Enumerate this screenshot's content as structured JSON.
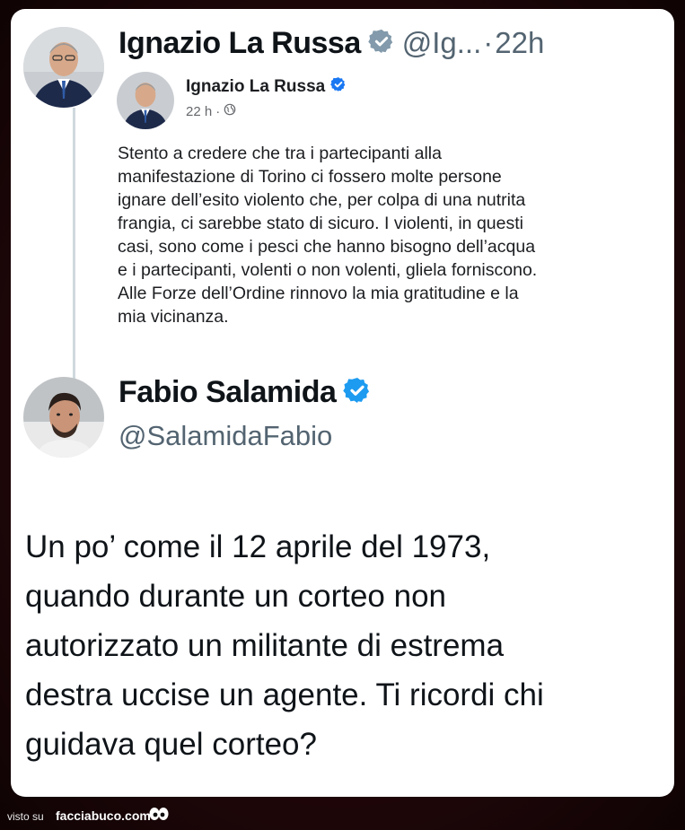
{
  "quote_tweet": {
    "author_name": "Ignazio La Russa",
    "handle": "@Ig...",
    "separator": "·",
    "time": "22h",
    "avatar_icon": "portrait-avatar-icon",
    "verified_icon": "verified-badge-icon"
  },
  "embedded_post": {
    "author_name": "Ignazio La Russa",
    "time": "22 h",
    "dot": "·",
    "audience_icon": "globe-icon",
    "body_lines": [
      "Stento a credere che tra i partecipanti alla",
      "manifestazione di Torino ci fossero molte persone",
      "ignare dell’esito violento che, per colpa di una nutrita",
      "frangia, ci sarebbe stato di sicuro. I violenti, in questi",
      "casi, sono come i pesci che hanno bisogno dell’acqua",
      "e i partecipanti, volenti o non volenti, gliela forniscono.",
      "Alle Forze dell’Ordine rinnovo la mia gratitudine e la",
      "mia vicinanza."
    ]
  },
  "reply_tweet": {
    "author_name": "Fabio Salamida",
    "handle": "@SalamidaFabio",
    "verified_icon": "verified-badge-icon",
    "body_lines": [
      "Un po’ come il 12 aprile del 1973,",
      "quando durante un corteo non",
      "autorizzato un militante di estrema",
      "destra uccise un agente. Ti ricordi chi",
      "guidava quel corteo?"
    ]
  },
  "footer": {
    "visto_label": "visto su",
    "brand": "facciabuco.com",
    "logo_icon": "eyes-logo-icon"
  },
  "colors": {
    "verified_blue": "#1d9bf0",
    "frame_background": "#2a0a0c",
    "card_background": "#ffffff",
    "secondary_text": "#536471"
  }
}
